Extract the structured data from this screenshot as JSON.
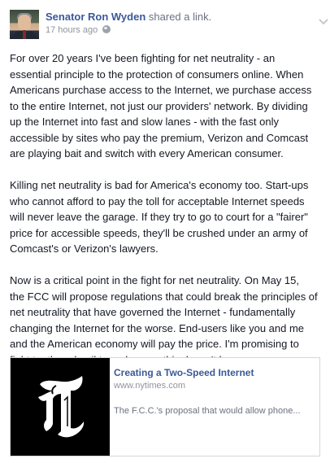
{
  "post": {
    "author": "Senator Ron Wyden",
    "action": "shared a link.",
    "timestamp": "17 hours ago",
    "audience_icon": "globe-icon",
    "menu_icon": "chevron-down-icon",
    "paragraphs": [
      "For over 20 years I've been fighting for net neutrality - an\nessential principle to the protection of consumers online. When\nAmericans purchase access to the Internet, we purchase access\nto the entire Internet, not just our providers' network. By dividing\nup the Internet into fast and slow lanes - with the fast only\naccessible by sites who pay the premium, Verizon and Comcast\nare playing bait and switch with every American consumer.",
      "Killing net neutrality is bad for America's economy too. Start-ups\nwho cannot afford to pay the toll for acceptable Internet speeds\nwill never leave the garage. If they try to go to court for a \"fairer\"\nprice for accessible speeds, they'll be crushed under an army of\nComcast's or Verizon's lawyers.",
      "Now is a critical point in the fight for net neutrality. On May 15,\nthe FCC will propose regulations that could break the principles of\nnet neutrality that have governed the Internet - fundamentally\nchanging the Internet for the worse. End-users like you and me\nand the American economy will pay the price. I'm promising to\nfight tooth and nail to make sure this doesn't happen."
    ]
  },
  "link": {
    "title": "Creating a Two-Speed Internet",
    "domain": "www.nytimes.com",
    "description": "The F.C.C.'s proposal that would allow phone...",
    "thumbnail_logo": "T",
    "thumbnail_icon": "nytimes-logo-icon"
  },
  "colors": {
    "link_blue": "#3b5998",
    "meta_gray": "#90949c",
    "text": "#141823",
    "card_border": "#d3d6db",
    "thumb_bg": "#000000"
  }
}
